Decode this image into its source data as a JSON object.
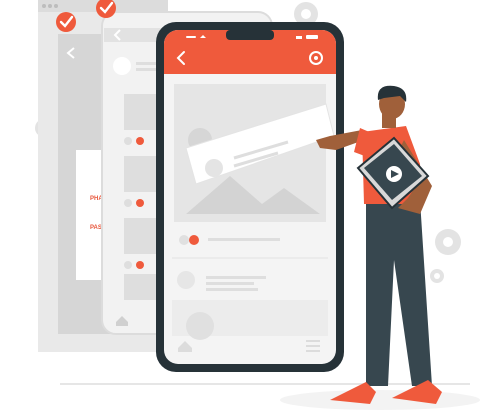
{
  "palette": {
    "accent": "#ef5a3c",
    "phone_frame": "#263238",
    "screen_bg": "#f5f5f5",
    "placeholder": "#e0e0e0",
    "placeholder_dark": "#cfcfcf",
    "skin": "#a0603a",
    "pants": "#37474f",
    "shirt": "#ef5a3c"
  },
  "back_screen": {
    "labels": [
      "PHA",
      "PAS"
    ]
  },
  "middle_screen": {
    "likes": 2
  },
  "phone": {
    "header_icons": [
      "back-arrow-icon",
      "gear-icon"
    ],
    "status_icons": [
      "wifi-icon",
      "signal-icon",
      "battery-icon"
    ],
    "cards": 2
  },
  "icons": [
    "checkmark-badge-icon",
    "gear-icon",
    "home-icon",
    "menu-icon",
    "heart-icon",
    "play-icon",
    "avatar-icon",
    "image-icon"
  ]
}
